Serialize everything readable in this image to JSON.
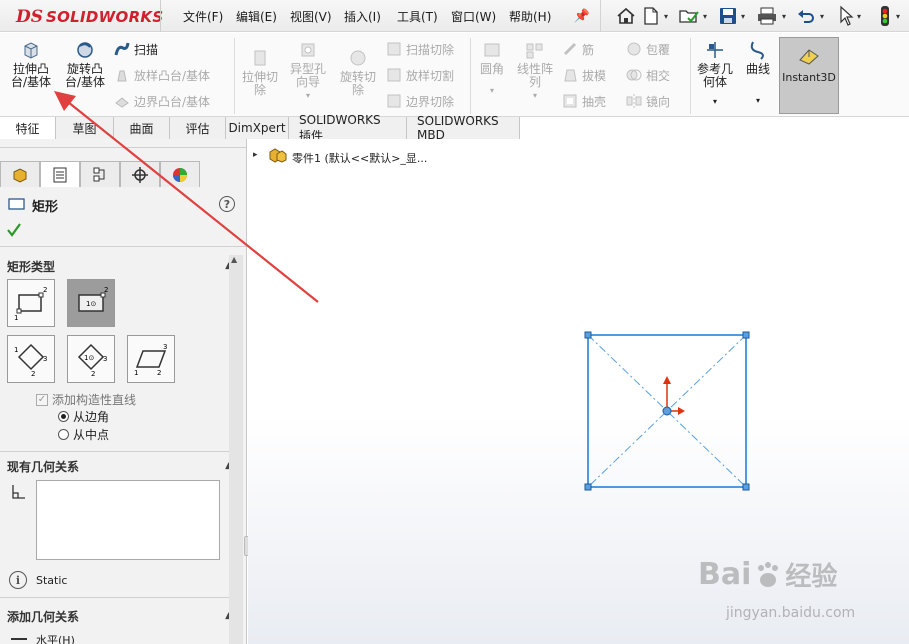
{
  "app": {
    "logo_ds": "DS",
    "logo_text": "SOLIDWORKS"
  },
  "menu": [
    "文件(F)",
    "编辑(E)",
    "视图(V)",
    "插入(I)",
    "工具(T)",
    "窗口(W)",
    "帮助(H)"
  ],
  "ribbon": {
    "extrude_boss": "拉伸凸台/基体",
    "revolve_boss": "旋转凸台/基体",
    "sweep": "扫描",
    "loft_boss": "放样凸台/基体",
    "boundary_boss": "边界凸台/基体",
    "extrude_cut": "拉伸切除",
    "hole_wizard": "异型孔向导",
    "revolve_cut": "旋转切除",
    "swept_cut": "扫描切除",
    "lofted_cut": "放样切割",
    "boundary_cut": "边界切除",
    "fillet": "圆角",
    "linear_pattern": "线性阵列",
    "rib": "筋",
    "draft": "拔模",
    "shell": "抽壳",
    "wrap": "包覆",
    "intersect": "相交",
    "mirror": "镜向",
    "ref_geometry": "参考几何体",
    "curves": "曲线",
    "instant3d": "Instant3D"
  },
  "tabs": [
    "特征",
    "草图",
    "曲面",
    "评估",
    "DimXpert",
    "SOLIDWORKS 插件",
    "SOLIDWORKS MBD"
  ],
  "feature_tree": {
    "root": "零件1  (默认<<默认>_显..."
  },
  "property_manager": {
    "title": "矩形",
    "help": "?",
    "rect_type_header": "矩形类型",
    "add_construction": "添加构造性直线",
    "from_corner": "从边角",
    "from_midpoint": "从中点",
    "existing_rel_header": "现有几何关系",
    "status": "Static",
    "add_rel_header": "添加几何关系",
    "horizontal": "水平(H)"
  },
  "watermark": {
    "brand": "Bai",
    "brand2": "经验",
    "url": "jingyan.baidu.com"
  }
}
